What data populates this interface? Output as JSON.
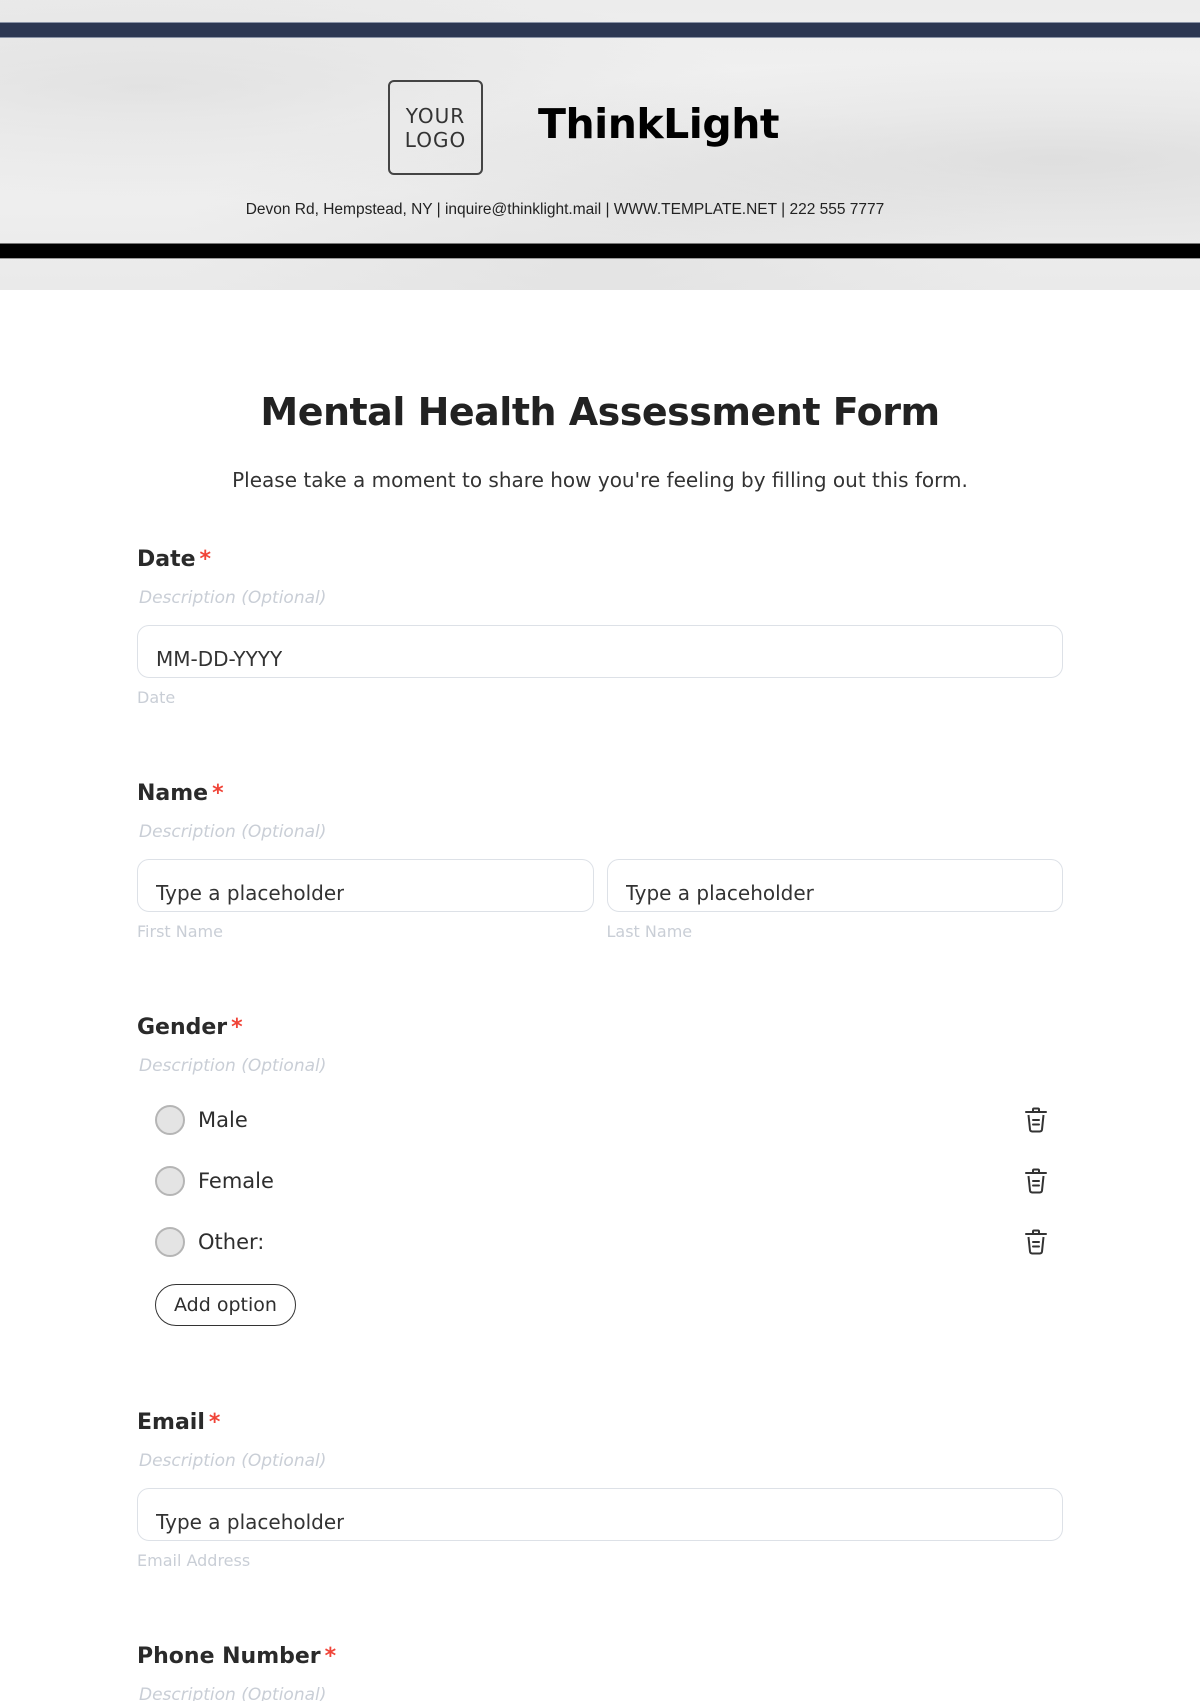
{
  "header": {
    "logo_line1": "YOUR",
    "logo_line2": "LOGO",
    "brand_name": "ThinkLight",
    "contact_line": "Devon Rd, Hempstead, NY | inquire@thinklight.mail | WWW.TEMPLATE.NET | 222 555 7777",
    "colors": {
      "top_bar": "#2c3752",
      "bottom_bar": "#000000"
    }
  },
  "form": {
    "title": "Mental Health Assessment Form",
    "subtitle": "Please take a moment to share how you're feeling by filling out this form.",
    "required_marker": "*",
    "required_color": "#f04438",
    "fields": {
      "date": {
        "label": "Date",
        "description": "Description (Optional)",
        "placeholder": "MM-DD-YYYY",
        "sublabel": "Date"
      },
      "name": {
        "label": "Name",
        "description": "Description (Optional)",
        "first": {
          "placeholder": "Type a placeholder",
          "sublabel": "First Name"
        },
        "last": {
          "placeholder": "Type a placeholder",
          "sublabel": "Last Name"
        }
      },
      "gender": {
        "label": "Gender",
        "description": "Description (Optional)",
        "options": [
          {
            "label": "Male",
            "icon": "trash-icon"
          },
          {
            "label": "Female",
            "icon": "trash-icon"
          },
          {
            "label": "Other:",
            "icon": "trash-icon"
          }
        ],
        "add_option_label": "Add option"
      },
      "email": {
        "label": "Email",
        "description": "Description (Optional)",
        "placeholder": "Type a placeholder",
        "sublabel": "Email Address"
      },
      "phone": {
        "label": "Phone Number",
        "description": "Description (Optional)"
      }
    }
  }
}
